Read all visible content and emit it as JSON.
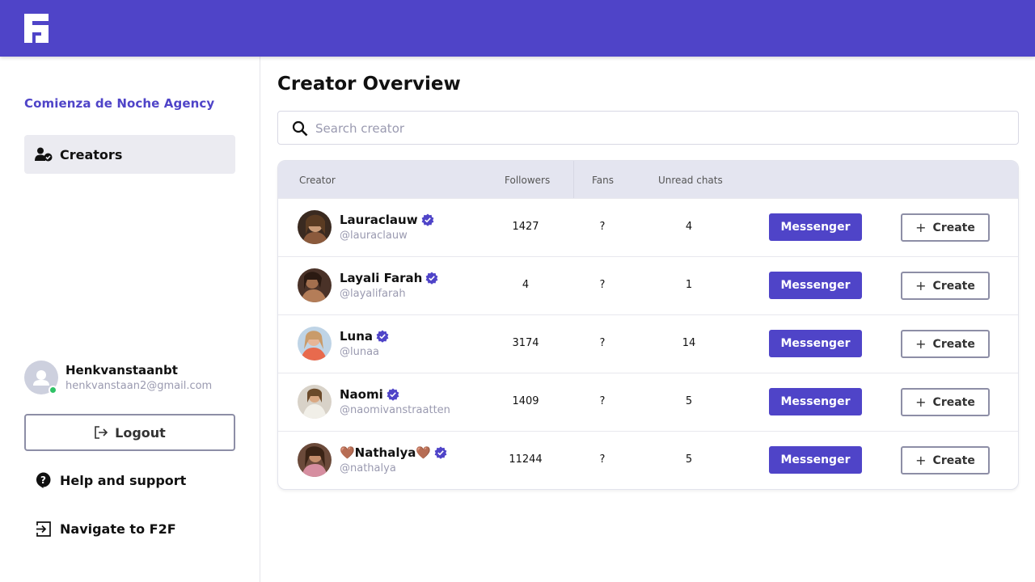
{
  "brand": {
    "color": "#4f44c8",
    "logo_icon": "f2f-logo-icon"
  },
  "sidebar": {
    "agency_name": "Comienza de Noche Agency",
    "nav_items": [
      {
        "label": "Creators",
        "icon": "user-check-icon",
        "active": true
      }
    ],
    "user": {
      "name": "Henkvanstaanbt",
      "email": "henkvanstaan2@gmail.com",
      "status": "online",
      "status_color": "#2fc266"
    },
    "logout_label": "Logout",
    "help_label": "Help and support",
    "navigate_label": "Navigate to F2F"
  },
  "main": {
    "title": "Creator Overview",
    "search": {
      "placeholder": "Search creator",
      "value": ""
    },
    "table": {
      "headers": {
        "creator": "Creator",
        "followers": "Followers",
        "fans": "Fans",
        "unread": "Unread chats"
      },
      "rows": [
        {
          "name": "Lauraclauw",
          "handle": "@lauraclauw",
          "followers": "1427",
          "fans": "?",
          "unread": "4",
          "verified": true,
          "messenger_label": "Messenger",
          "create_label": "Create"
        },
        {
          "name": "Layali Farah",
          "handle": "@layalifarah",
          "followers": "4",
          "fans": "?",
          "unread": "1",
          "verified": true,
          "messenger_label": "Messenger",
          "create_label": "Create"
        },
        {
          "name": "Luna",
          "handle": "@lunaa",
          "followers": "3174",
          "fans": "?",
          "unread": "14",
          "verified": true,
          "messenger_label": "Messenger",
          "create_label": "Create"
        },
        {
          "name": "Naomi",
          "handle": "@naomivanstraatten",
          "followers": "1409",
          "fans": "?",
          "unread": "5",
          "verified": true,
          "messenger_label": "Messenger",
          "create_label": "Create"
        },
        {
          "name": "🤎Nathalya🤎",
          "handle": "@nathalya",
          "followers": "11244",
          "fans": "?",
          "unread": "5",
          "verified": true,
          "messenger_label": "Messenger",
          "create_label": "Create"
        }
      ]
    }
  }
}
